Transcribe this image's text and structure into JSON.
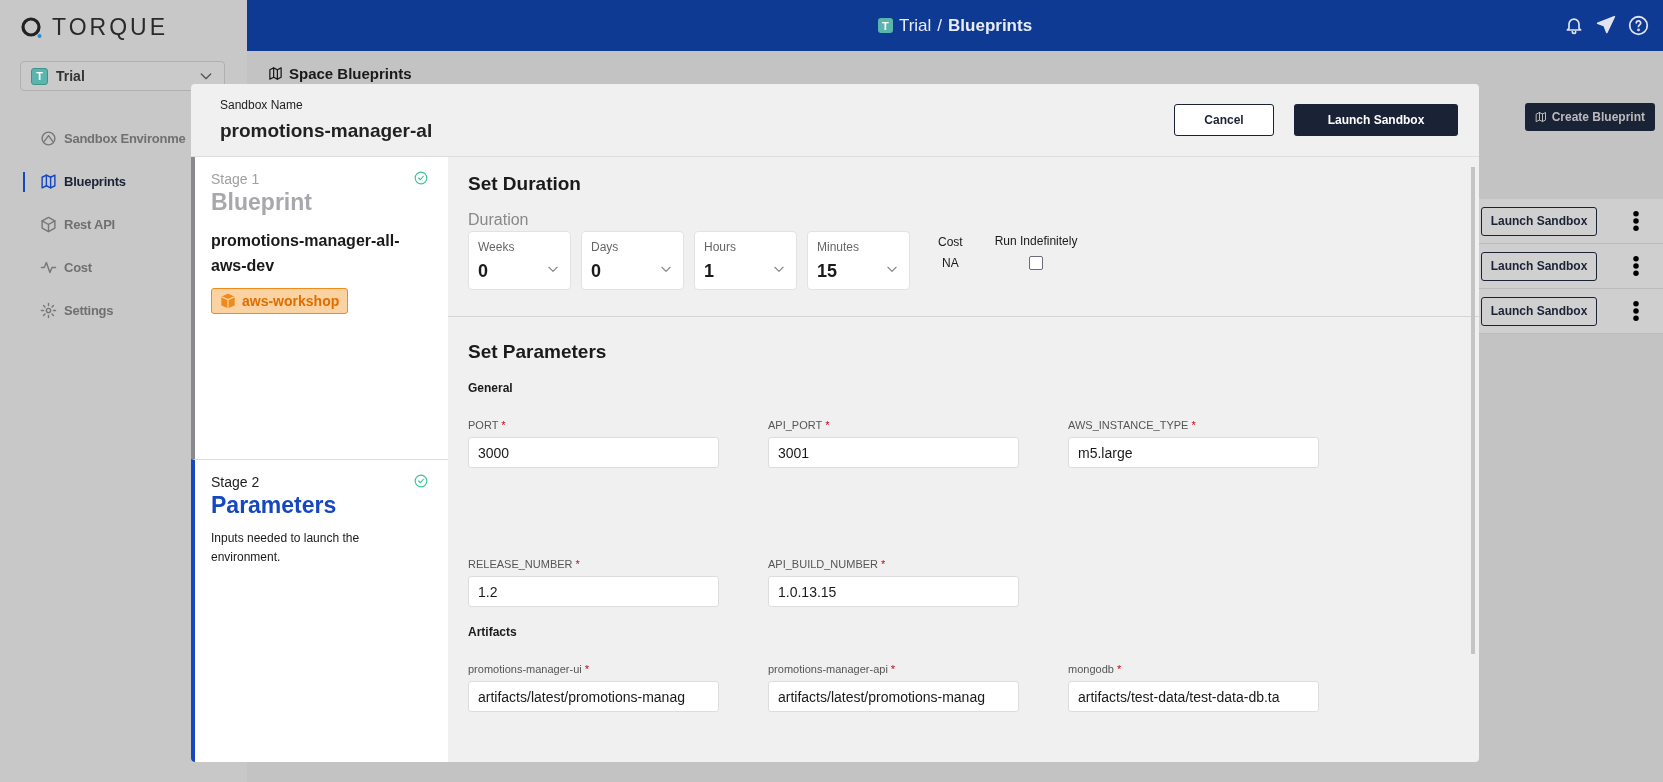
{
  "app": {
    "logo": "TORQUE"
  },
  "space_selector": {
    "badge": "T",
    "label": "Trial"
  },
  "nav": [
    {
      "label": "Sandbox Environme",
      "selected": false
    },
    {
      "label": "Blueprints",
      "selected": true
    },
    {
      "label": "Rest API",
      "selected": false
    },
    {
      "label": "Cost",
      "selected": false
    },
    {
      "label": "Settings",
      "selected": false
    }
  ],
  "header": {
    "badge": "T",
    "space": "Trial",
    "separator": "/",
    "page": "Blueprints"
  },
  "page": {
    "title": "Space Blueprints",
    "create_button": "Create Blueprint",
    "rows": [
      {
        "action": "Launch Sandbox"
      },
      {
        "action": "Launch Sandbox"
      },
      {
        "action": "Launch Sandbox"
      }
    ]
  },
  "modal": {
    "name_label": "Sandbox Name",
    "name_value": "promotions-manager-al",
    "buttons": [
      {
        "label": "Cancel",
        "kind": "secondary"
      },
      {
        "label": "Launch Sandbox",
        "kind": "primary"
      }
    ],
    "stages": [
      {
        "stage": "Stage 1",
        "title": "Blueprint",
        "selected": false,
        "done": true,
        "name": "promotions-manager-all-aws-dev",
        "tag": "aws-workshop"
      },
      {
        "stage": "Stage 2",
        "title": "Parameters",
        "selected": true,
        "done": true,
        "description": "Inputs needed to launch the environment."
      }
    ],
    "duration": {
      "title": "Set Duration",
      "label": "Duration",
      "selects": [
        {
          "label": "Weeks",
          "value": "0"
        },
        {
          "label": "Days",
          "value": "0"
        },
        {
          "label": "Hours",
          "value": "1"
        },
        {
          "label": "Minutes",
          "value": "15"
        }
      ],
      "cost_label": "Cost",
      "cost_value": "NA",
      "run_indefinitely": {
        "label": "Run Indefinitely",
        "checked": false
      }
    },
    "parameters": {
      "title": "Set Parameters",
      "groups": [
        {
          "title": "General",
          "rows": [
            [
              {
                "label": "PORT",
                "mark": "*",
                "value": "3000"
              },
              {
                "label": "API_PORT",
                "mark": "*",
                "value": "3001"
              },
              {
                "label": "AWS_INSTANCE_TYPE",
                "mark": "*",
                "value": "m5.large"
              }
            ],
            [
              {
                "label": "RELEASE_NUMBER",
                "mark": "*",
                "value": "1.2"
              },
              {
                "label": "API_BUILD_NUMBER",
                "mark": "*",
                "value": "1.0.13.15"
              }
            ]
          ]
        },
        {
          "title": "Artifacts",
          "rows": [
            [
              {
                "label": "promotions-manager-ui",
                "mark": "*",
                "value": "artifacts/latest/promotions-manag"
              },
              {
                "label": "promotions-manager-api",
                "mark": "*",
                "value": "artifacts/latest/promotions-manag"
              },
              {
                "label": "mongodb",
                "mark": "*",
                "value": "artifacts/test-data/test-data-db.ta"
              }
            ]
          ]
        }
      ]
    }
  }
}
